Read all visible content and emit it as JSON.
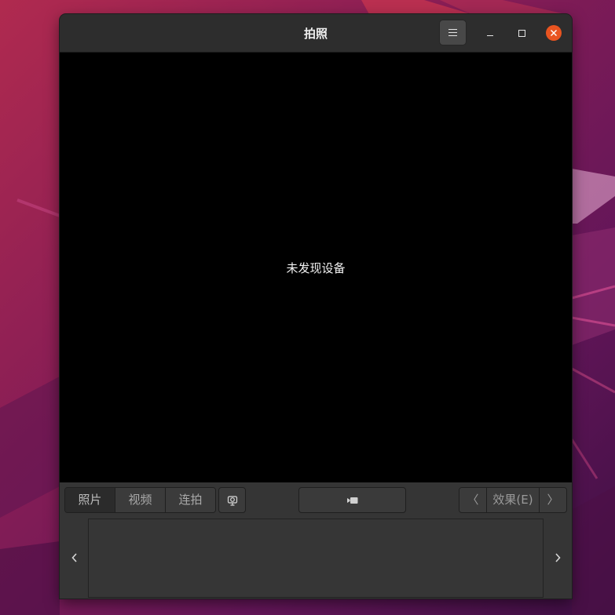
{
  "window": {
    "title": "拍照",
    "menu_icon": "hamburger-menu-icon",
    "minimize_icon": "minimize-icon",
    "maximize_icon": "maximize-icon",
    "close_icon": "close-icon",
    "close_color": "#e95420"
  },
  "viewport": {
    "status_text": "未发现设备",
    "background": "#000000"
  },
  "toolbar": {
    "modes": [
      {
        "label": "照片",
        "active": true
      },
      {
        "label": "视频",
        "active": false
      },
      {
        "label": "连拍",
        "active": false
      }
    ],
    "settings_icon": "camera-settings-icon",
    "record_icon": "video-camera-icon",
    "effects": {
      "prev": "〈",
      "label": "效果(E)",
      "next": "〉"
    }
  },
  "thumbnail_strip": {
    "prev_icon": "chevron-left-icon",
    "next_icon": "chevron-right-icon"
  },
  "colors": {
    "accent": "#e95420",
    "window_bg": "#353535",
    "titlebar_bg": "#2d2d2d"
  }
}
